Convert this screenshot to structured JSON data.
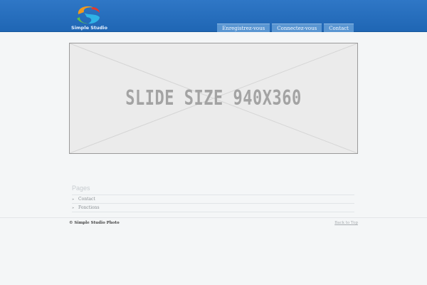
{
  "header": {
    "logo_text": "Simple Studio",
    "nav": [
      {
        "label": "Enregistrez-vous"
      },
      {
        "label": "Connectez-vous"
      },
      {
        "label": "Contact"
      }
    ]
  },
  "slider": {
    "placeholder_text": "SLIDE SIZE 940X360"
  },
  "pages": {
    "title": "Pages",
    "items": [
      {
        "label": "Contact"
      },
      {
        "label": "Fonctions"
      }
    ]
  },
  "footer": {
    "copyright": "© Simple Studio Photo",
    "back_to_top": "Back to Top"
  },
  "colors": {
    "header": "#1f66b4",
    "nav_button": "#5a96d2",
    "background": "#f4f6f7"
  }
}
